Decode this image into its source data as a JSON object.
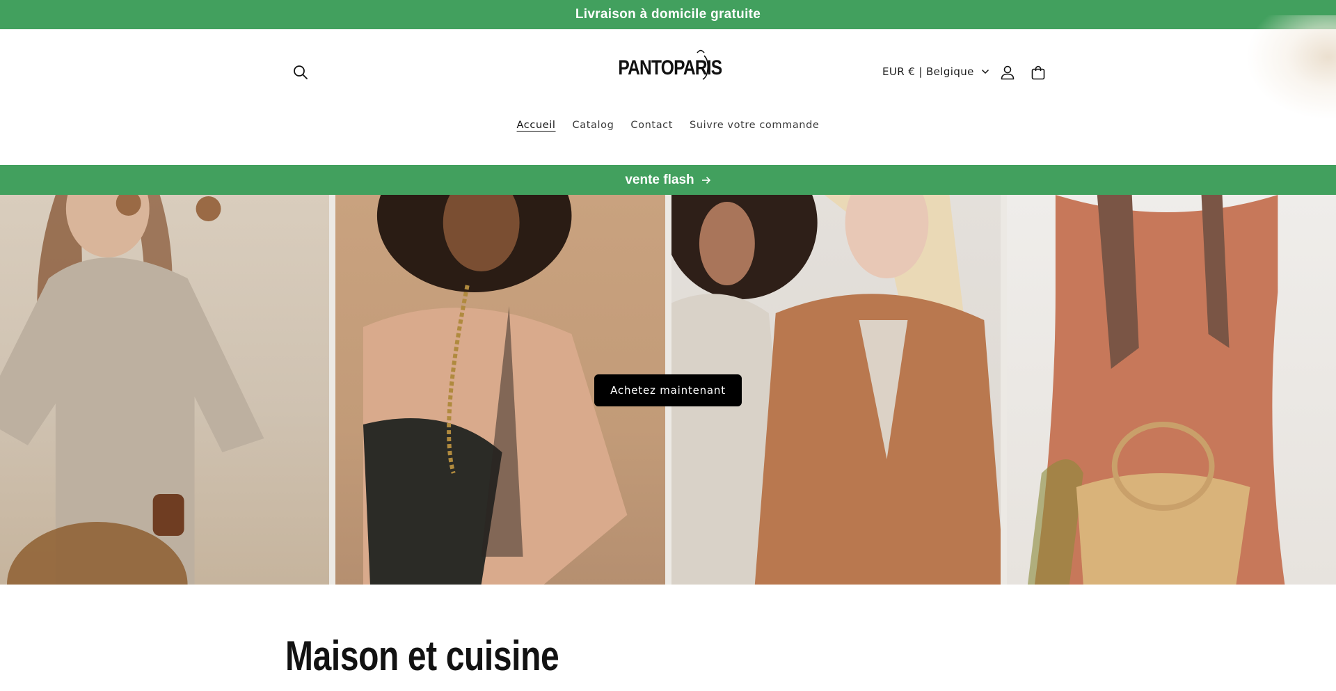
{
  "announcement": {
    "text": "Livraison à domicile gratuite"
  },
  "header": {
    "logo_text": "PANTOPARIS",
    "currency": {
      "selected": "EUR € | Belgique"
    },
    "icons": {
      "search": "search-icon",
      "account": "user-icon",
      "cart": "bag-icon",
      "currency_toggle": "chevron-down-icon"
    }
  },
  "nav": {
    "items": [
      {
        "label": "Accueil",
        "active": true
      },
      {
        "label": "Catalog"
      },
      {
        "label": "Contact"
      },
      {
        "label": "Suivre votre commande"
      }
    ]
  },
  "flash": {
    "label": "vente flash",
    "icon": "arrow-right-icon"
  },
  "hero": {
    "cta_label": "Achetez maintenant"
  },
  "section": {
    "title": "Maison et cuisine"
  },
  "colors": {
    "accent": "#42a05e",
    "button": "#000000"
  }
}
